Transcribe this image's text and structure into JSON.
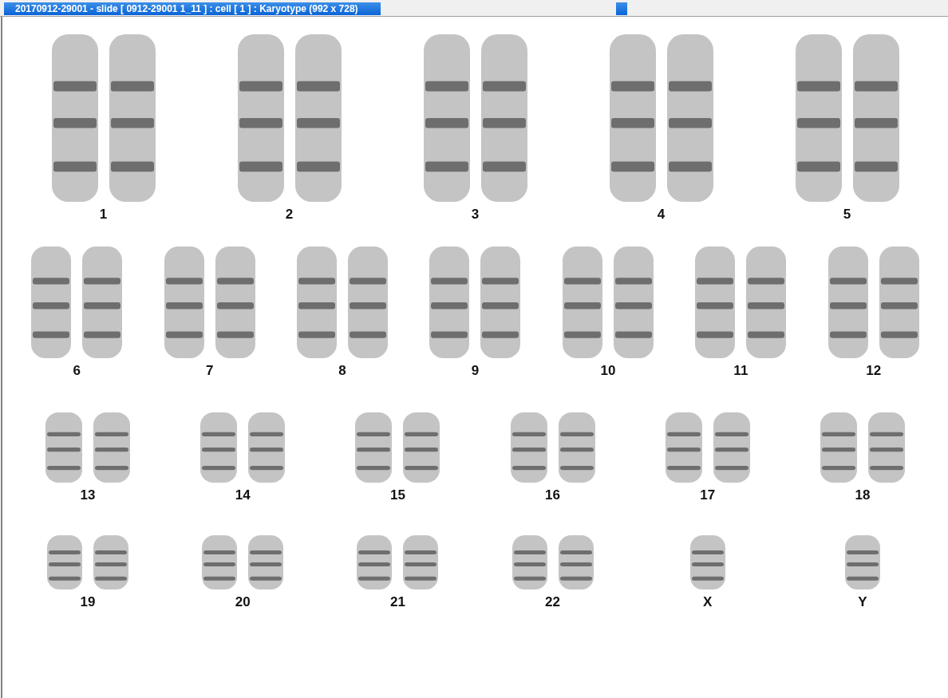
{
  "window": {
    "title": "20170912-29001 - slide [ 0912-29001 1_11 ] : cell [ 1 ] : Karyotype  (992 x 728)"
  },
  "rows": [
    {
      "chromosomes": [
        {
          "label": "1",
          "kind": "pair"
        },
        {
          "label": "2",
          "kind": "pair"
        },
        {
          "label": "3",
          "kind": "pair"
        },
        {
          "label": "4",
          "kind": "pair"
        },
        {
          "label": "5",
          "kind": "pair"
        }
      ]
    },
    {
      "chromosomes": [
        {
          "label": "6",
          "kind": "pair"
        },
        {
          "label": "7",
          "kind": "pair"
        },
        {
          "label": "8",
          "kind": "pair"
        },
        {
          "label": "9",
          "kind": "pair"
        },
        {
          "label": "10",
          "kind": "pair"
        },
        {
          "label": "11",
          "kind": "pair"
        },
        {
          "label": "12",
          "kind": "pair"
        }
      ]
    },
    {
      "chromosomes": [
        {
          "label": "13",
          "kind": "pair"
        },
        {
          "label": "14",
          "kind": "pair"
        },
        {
          "label": "15",
          "kind": "pair"
        },
        {
          "label": "16",
          "kind": "pair"
        },
        {
          "label": "17",
          "kind": "pair"
        },
        {
          "label": "18",
          "kind": "pair"
        }
      ]
    },
    {
      "chromosomes": [
        {
          "label": "19",
          "kind": "pair"
        },
        {
          "label": "20",
          "kind": "pair"
        },
        {
          "label": "21",
          "kind": "pair"
        },
        {
          "label": "22",
          "kind": "pair"
        },
        {
          "label": "X",
          "kind": "single"
        },
        {
          "label": "Y",
          "kind": "single"
        }
      ]
    }
  ]
}
